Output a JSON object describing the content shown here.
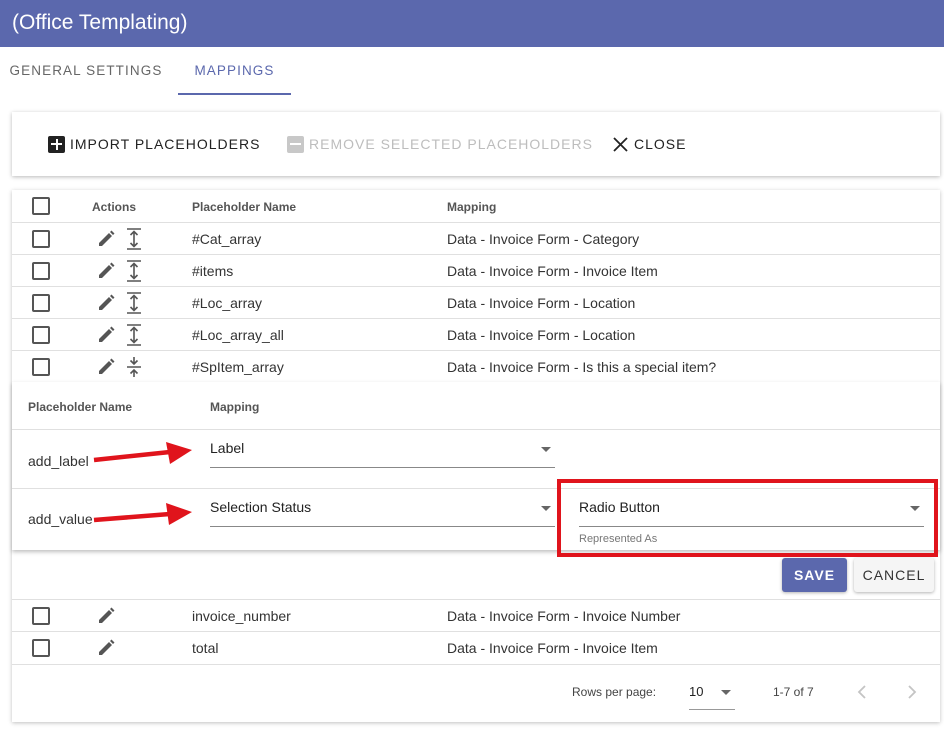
{
  "app": {
    "title": "(Office Templating)"
  },
  "tabs": [
    {
      "label": "GENERAL SETTINGS",
      "active": false
    },
    {
      "label": "MAPPINGS",
      "active": true
    }
  ],
  "toolbar": {
    "import_label": "IMPORT PLACEHOLDERS",
    "remove_label": "REMOVE SELECTED PLACEHOLDERS",
    "close_label": "CLOSE"
  },
  "table": {
    "headers": {
      "actions": "Actions",
      "placeholder": "Placeholder Name",
      "mapping": "Mapping"
    },
    "rows": [
      {
        "placeholder": "#Cat_array",
        "mapping": "Data - Invoice Form - Category",
        "expand_icon": "expand-icon"
      },
      {
        "placeholder": "#items",
        "mapping": "Data - Invoice Form - Invoice Item",
        "expand_icon": "expand-icon"
      },
      {
        "placeholder": "#Loc_array",
        "mapping": "Data - Invoice Form - Location",
        "expand_icon": "expand-icon"
      },
      {
        "placeholder": "#Loc_array_all",
        "mapping": "Data - Invoice Form - Location",
        "expand_icon": "expand-icon"
      },
      {
        "placeholder": "#SpItem_array",
        "mapping": "Data - Invoice Form - Is this a special item?",
        "expand_icon": "collapse-icon"
      }
    ],
    "rows_after": [
      {
        "placeholder": "invoice_number",
        "mapping": "Data - Invoice Form - Invoice Number"
      },
      {
        "placeholder": "total",
        "mapping": "Data - Invoice Form - Invoice Item"
      }
    ]
  },
  "nested": {
    "headers": {
      "placeholder": "Placeholder Name",
      "mapping": "Mapping"
    },
    "rows": [
      {
        "placeholder": "add_label",
        "mapping": "Label"
      },
      {
        "placeholder": "add_value",
        "mapping": "Selection Status",
        "represented_as": "Radio Button",
        "represented_as_label": "Represented As"
      }
    ],
    "save_label": "SAVE",
    "cancel_label": "CANCEL"
  },
  "pager": {
    "rows_per_page_label": "Rows per page:",
    "rows_per_page": "10",
    "range": "1-7 of 7"
  },
  "colors": {
    "primary": "#5b68ad",
    "annotation": "#e0141c"
  }
}
